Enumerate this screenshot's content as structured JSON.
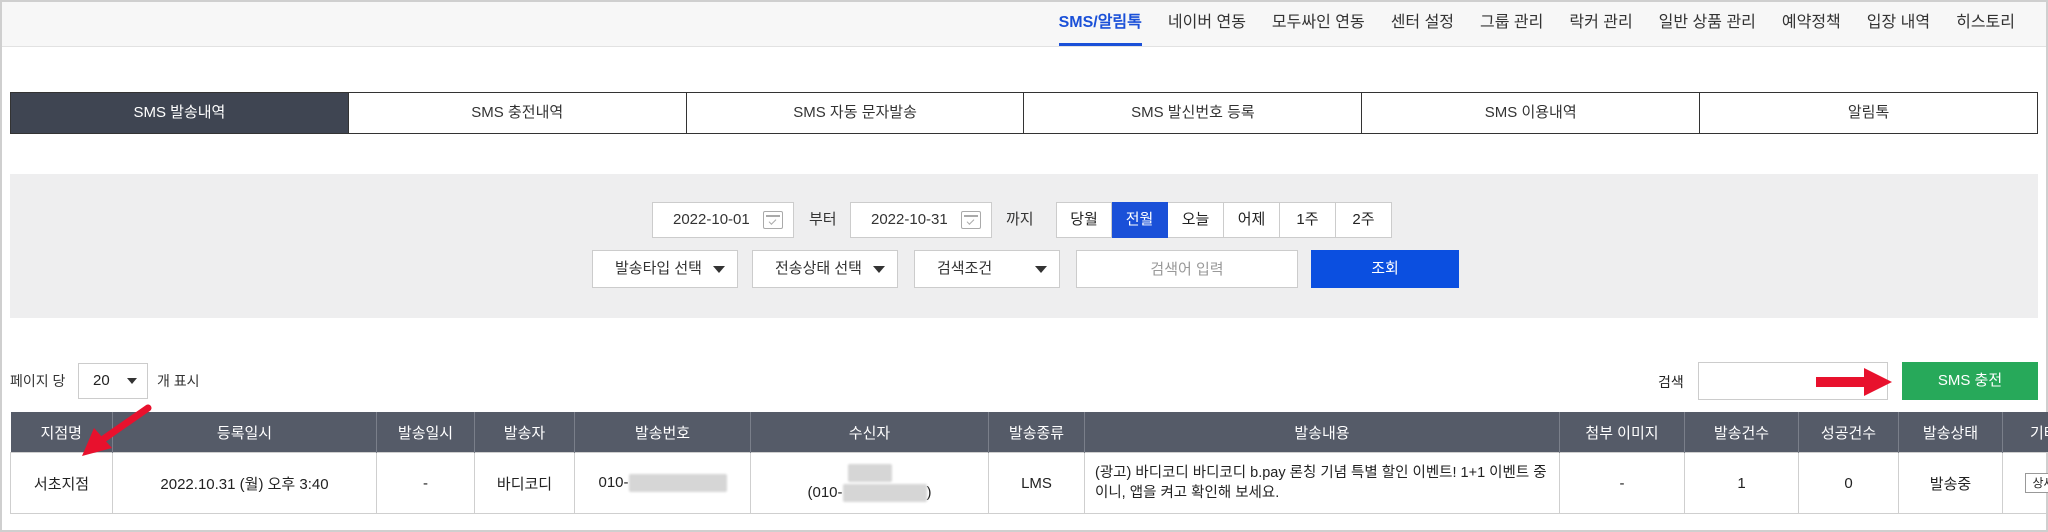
{
  "nav": {
    "items": [
      "SMS/알림톡",
      "네이버 연동",
      "모두싸인 연동",
      "센터 설정",
      "그룹 관리",
      "락커 관리",
      "일반 상품 관리",
      "예약정책",
      "입장 내역",
      "히스토리"
    ],
    "active_index": 0
  },
  "tabs": {
    "items": [
      "SMS 발송내역",
      "SMS 충전내역",
      "SMS 자동 문자발송",
      "SMS 발신번호 등록",
      "SMS 이용내역",
      "알림톡"
    ],
    "active_index": 0
  },
  "filter": {
    "date_from": "2022-10-01",
    "from_label": "부터",
    "date_to": "2022-10-31",
    "to_label": "까지",
    "periods": [
      "당월",
      "전월",
      "오늘",
      "어제",
      "1주",
      "2주"
    ],
    "active_period_index": 1,
    "send_type": "발송타입 선택",
    "send_status": "전송상태 선택",
    "search_condition": "검색조건",
    "keyword_placeholder": "검색어 입력",
    "search_button": "조회"
  },
  "page_controls": {
    "per_page_label": "페이지 당",
    "per_page_value": "20",
    "show_label": "개 표시",
    "search_label": "검색",
    "charge_button": "SMS 충전"
  },
  "table": {
    "headers": [
      "지점명",
      "등록일시",
      "발송일시",
      "발송자",
      "발송번호",
      "수신자",
      "발송종류",
      "발송내용",
      "첨부 이미지",
      "발송건수",
      "성공건수",
      "발송상태",
      "기타"
    ],
    "rows": [
      {
        "branch": "서초지점",
        "registered": "2022.10.31 (월) 오후 3:40",
        "sent_at": "-",
        "sender": "바디코디",
        "send_number_prefix": "010-",
        "recipient_prefix": "(010-",
        "recipient_suffix": ")",
        "type": "LMS",
        "content": "(광고) 바디코디 바디코디 b.pay 론칭 기념 특별 할인 이벤트! 1+1 이벤트 중이니, 앱을 켜고 확인해 보세요.",
        "attachment": "-",
        "send_count": "1",
        "success_count": "0",
        "status": "발송중",
        "detail_button": "상세"
      }
    ]
  },
  "colors": {
    "primary_blue": "#1a50d8",
    "tab_active_bg": "#3f4552",
    "table_header_bg": "#555b68",
    "charge_green": "#27a95a",
    "status_red": "#e2421e",
    "annotation_arrow_red": "#e8112d"
  }
}
